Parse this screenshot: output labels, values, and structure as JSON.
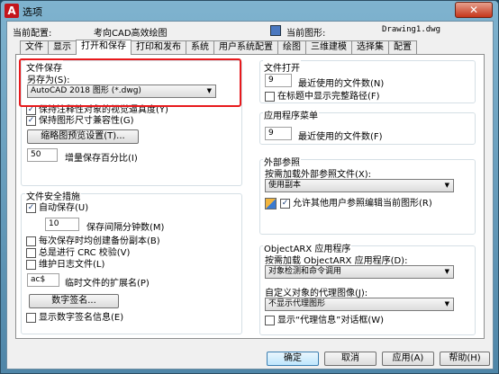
{
  "window": {
    "title": "选项",
    "close_glyph": "✕"
  },
  "header": {
    "profile_label": "当前配置:",
    "profile_value": "考向CAD高效绘图",
    "drawing_label": "当前图形:",
    "drawing_value": "Drawing1.dwg"
  },
  "tabs": [
    "文件",
    "显示",
    "打开和保存",
    "打印和发布",
    "系统",
    "用户系统配置",
    "绘图",
    "三维建模",
    "选择集",
    "配置"
  ],
  "active_tab": "打开和保存",
  "save": {
    "group_title": "文件保存",
    "save_as_label": "另存为(S):",
    "save_as_value": "AutoCAD 2018 图形 (*.dwg)",
    "maintain_visual": "保持注释性对象的视觉逼真度(Y)",
    "maintain_drawing": "保持图形尺寸兼容性(G)",
    "thumbnail_button": "缩略图预览设置(T)...",
    "incremental_value": "50",
    "incremental_label": "增量保存百分比(I)"
  },
  "safety": {
    "group_title": "文件安全措施",
    "autosave": "自动保存(U)",
    "autosave_minutes": "10",
    "autosave_minutes_label": "保存间隔分钟数(M)",
    "backup": "每次保存时均创建备份副本(B)",
    "crc": "总是进行 CRC 校验(V)",
    "log": "维护日志文件(L)",
    "temp_ext_value": "ac$",
    "temp_ext_label": "临时文件的扩展名(P)",
    "digital_sig_button": "数字签名...",
    "show_sig": "显示数字签名信息(E)"
  },
  "file_open": {
    "group_title": "文件打开",
    "recent_value": "9",
    "recent_label": "最近使用的文件数(N)",
    "full_path": "在标题中显示完整路径(F)"
  },
  "app_menu": {
    "group_title": "应用程序菜单",
    "recent_value": "9",
    "recent_label": "最近使用的文件数(F)"
  },
  "xrefs": {
    "group_title": "外部参照",
    "demand_load_label": "按需加载外部参照文件(X):",
    "demand_load_value": "使用副本",
    "allow_edit": "允许其他用户参照编辑当前图形(R)"
  },
  "objectarx": {
    "group_title": "ObjectARX 应用程序",
    "demand_load_label": "按需加载 ObjectARX 应用程序(D):",
    "demand_load_value": "对象检测和命令调用",
    "proxy_label": "自定义对象的代理图像(J):",
    "proxy_value": "不显示代理图形",
    "proxy_info": "显示“代理信息”对话框(W)"
  },
  "buttons": {
    "ok": "确定",
    "cancel": "取消",
    "apply": "应用(A)",
    "help": "帮助(H)"
  },
  "checks": {
    "maintain_visual": true,
    "maintain_drawing": true,
    "autosave": true,
    "backup": false,
    "crc": false,
    "log": false,
    "show_sig": false,
    "full_path": false,
    "proxy_info": false,
    "allow_edit": true
  }
}
